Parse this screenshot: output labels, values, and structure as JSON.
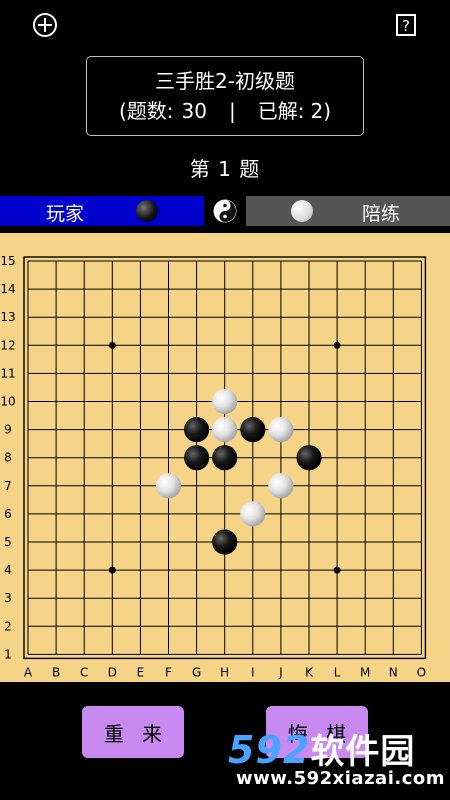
{
  "icons": {
    "add": "plus-circle-icon",
    "help": "question-box-icon"
  },
  "puzzle": {
    "title": "三手胜2-初级题",
    "stats": {
      "open": "(题数:",
      "count": "30",
      "separator": "|",
      "solved_label": "已解:",
      "solved": "2",
      "close": ")"
    }
  },
  "question_no": "第 1 题",
  "sides": {
    "player_label": "玩家",
    "player_stone": "black",
    "player_color": "#0000cd",
    "trainer_label": "陪练",
    "trainer_stone": "white",
    "trainer_color": "#555555"
  },
  "board": {
    "size": 15,
    "background": "#f5d488",
    "col_labels": [
      "A",
      "B",
      "C",
      "D",
      "E",
      "F",
      "G",
      "H",
      "I",
      "J",
      "K",
      "L",
      "M",
      "N",
      "O"
    ],
    "row_labels": [
      "15",
      "14",
      "13",
      "12",
      "11",
      "10",
      "9",
      "8",
      "7",
      "6",
      "5",
      "4",
      "3",
      "2",
      "1"
    ],
    "star_points": [
      "D12",
      "L12",
      "D4",
      "L4"
    ],
    "stones": [
      {
        "pos": "H10",
        "color": "white"
      },
      {
        "pos": "G9",
        "color": "black"
      },
      {
        "pos": "H9",
        "color": "white"
      },
      {
        "pos": "I9",
        "color": "black"
      },
      {
        "pos": "J9",
        "color": "white"
      },
      {
        "pos": "G8",
        "color": "black"
      },
      {
        "pos": "H8",
        "color": "black"
      },
      {
        "pos": "K8",
        "color": "black"
      },
      {
        "pos": "F7",
        "color": "white"
      },
      {
        "pos": "J7",
        "color": "white"
      },
      {
        "pos": "I6",
        "color": "white"
      },
      {
        "pos": "H5",
        "color": "black"
      }
    ]
  },
  "buttons": {
    "reset": "重 来",
    "undo": "悔 棋",
    "color": "#c88af0"
  },
  "watermark": {
    "logo_num": "592",
    "logo_cn": "软件园",
    "url": "www.592xiazai.com"
  }
}
